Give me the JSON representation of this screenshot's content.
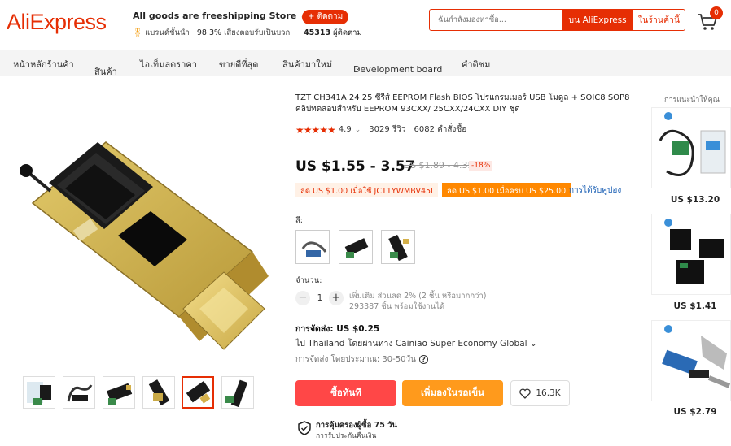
{
  "header": {
    "logo": "AliExpress",
    "store_name": "All goods are freeshipping Store",
    "store_caret": "⌄",
    "brand_label": "แบรนด์ชั้นนำ",
    "feedback_pct": "98.3%",
    "feedback_label": "เสียงตอบรับเป็นบวก",
    "follow_button": "+ ติดตาม",
    "followers_count": "45313",
    "followers_label": "ผู้ติดตาม",
    "search_placeholder": "ฉันกำลังมองหาซื้อ...",
    "search_all_button": "บน AliExpress",
    "search_store_button": "ในร้านค้านี้",
    "cart_count": "0"
  },
  "nav": {
    "items": [
      {
        "label": "หน้าหลักร้านค้า"
      },
      {
        "label": "สินค้า"
      },
      {
        "label": "ไอเท็มลดราคา"
      },
      {
        "label": "ขายดีที่สุด"
      },
      {
        "label": "สินค้ามาใหม่"
      },
      {
        "label": "Development board"
      },
      {
        "label": "คำติชม"
      }
    ]
  },
  "product": {
    "title": "TZT CH341A 24 25 ซีรีส์ EEPROM Flash BIOS โปรแกรมเมอร์ USB โมดูล + SOIC8 SOP8 คลิปทดสอบสำหรับ EEPROM 93CXX/ 25CXX/24CXX DIY ชุด",
    "stars": "★★★★★",
    "rating": "4.9",
    "reviews": "3029 รีวิว",
    "orders": "6082 คำสั่งซื้อ",
    "price": "US $1.55 - 3.57",
    "old_price": "US $1.89 - 4.35",
    "discount": "-18%",
    "coupon1": "ลด US $1.00 เมื่อใช้ JCT1YWMBV45I",
    "coupon2": "ลด US $1.00 เมื่อครบ US $25.00",
    "get_coupons": "การได้รับคูปอง",
    "color_label": "สี:",
    "quantity_label": "จำนวน:",
    "quantity": "1",
    "qty_minus": "−",
    "qty_plus": "+",
    "bulk_info": "เพิ่มเติม ส่วนลด 2% (2 ชิ้น หรือมากกว่า)",
    "stock_info": "293387 ชิ้น พร้อมใช้งานได้",
    "shipping_title": "การจัดส่ง: US $0.25",
    "shipping_to": "ไป Thailand โดยผ่านทาง Cainiao Super Economy Global ⌄",
    "shipping_estimate": "การจัดส่ง โดยประมาณ: 30-50วัน",
    "buy_now": "ซื้อทันที",
    "add_to_cart": "เพิ่มลงในรถเข็น",
    "wishlist_count": "16.3K",
    "protection_title": "การคุ้มครองผู้ซื้อ 75 วัน",
    "protection_sub": "การรับประกันคืนเงิน"
  },
  "recommendations": {
    "title": "การแนะนำให้คุณ",
    "items": [
      {
        "price": "US $13.20"
      },
      {
        "price": "US $1.41"
      },
      {
        "price": "US $2.79"
      }
    ]
  },
  "colors": {
    "brand": "#e62e04",
    "buy": "#ff4747",
    "cart": "#ff9a1c",
    "coupon_orange": "#ff8800"
  }
}
